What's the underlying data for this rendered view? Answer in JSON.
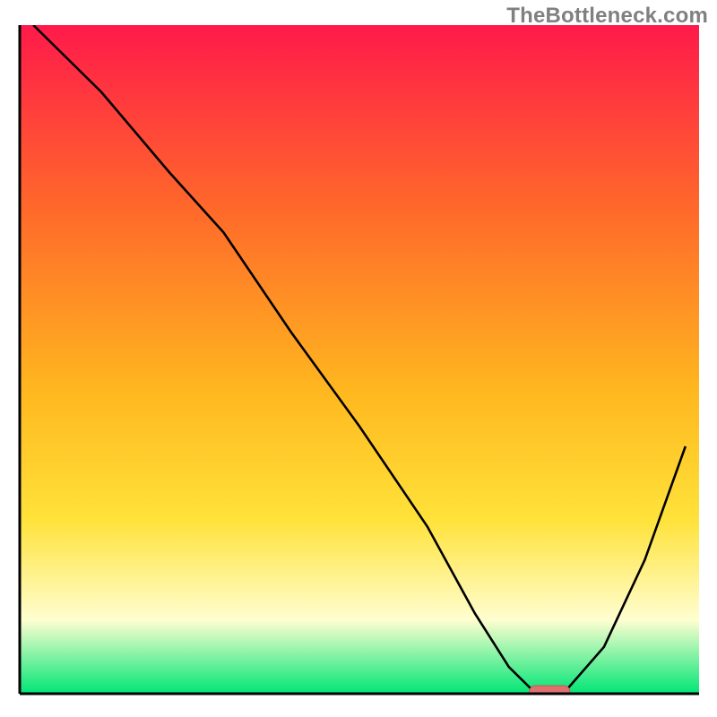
{
  "watermark": "TheBottleneck.com",
  "colors": {
    "gradient_top": "#ff1a4a",
    "gradient_mid1": "#ff6a2a",
    "gradient_mid2": "#ffb81f",
    "gradient_mid3": "#ffe23a",
    "gradient_pale": "#fffed0",
    "gradient_green": "#00e676",
    "curve": "#000000",
    "pill_fill": "#e07070",
    "pill_stroke": "#c05a5a",
    "axis": "#000000"
  },
  "chart_data": {
    "type": "line",
    "title": "",
    "xlabel": "",
    "ylabel": "",
    "xlim": [
      0,
      100
    ],
    "ylim": [
      0,
      100
    ],
    "series": [
      {
        "name": "bottleneck-curve",
        "x": [
          2,
          12,
          22,
          30,
          40,
          50,
          60,
          67,
          72,
          76,
          80,
          86,
          92,
          98
        ],
        "y": [
          100,
          90,
          78,
          69,
          54,
          40,
          25,
          12,
          4,
          0,
          0,
          7,
          20,
          37
        ]
      }
    ],
    "marker": {
      "name": "optimal-range",
      "x_center": 78,
      "y": 0,
      "width": 6
    },
    "grid": false,
    "legend": false
  }
}
